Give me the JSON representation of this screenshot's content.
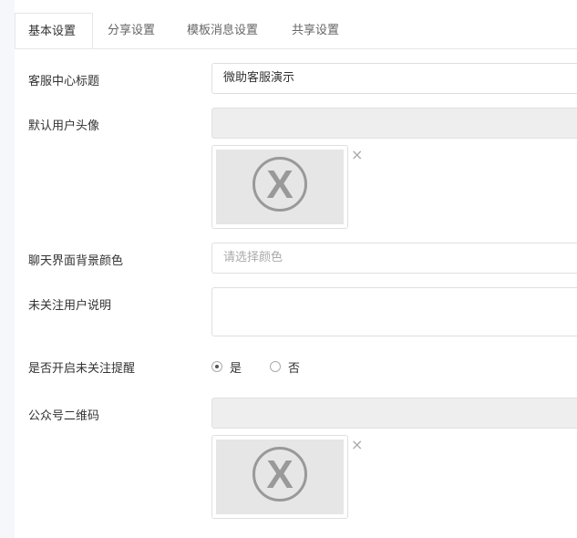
{
  "tabs": [
    {
      "label": "基本设置",
      "active": true
    },
    {
      "label": "分享设置",
      "active": false
    },
    {
      "label": "模板消息设置",
      "active": false
    },
    {
      "label": "共享设置",
      "active": false
    }
  ],
  "form": {
    "title_label": "客服中心标题",
    "title_value": "微助客服演示",
    "avatar_label": "默认用户头像",
    "avatar_value": "",
    "bgcolor_label": "聊天界面背景颜色",
    "bgcolor_placeholder": "请选择颜色",
    "unfollow_label": "未关注用户说明",
    "unfollow_value": "",
    "remind_label": "是否开启未关注提醒",
    "remind_options": [
      "是",
      "否"
    ],
    "remind_selected": "是",
    "qrcode_label": "公众号二维码",
    "qrcode_value": "",
    "remove_glyph": "×"
  },
  "icons": {
    "placeholder_image": "broken-image-x-icon",
    "remove": "close-icon"
  },
  "colors": {
    "background": "#f5f7fa",
    "panel": "#ffffff",
    "readonly_field": "#eeeeee",
    "border": "#dcdfe3"
  }
}
